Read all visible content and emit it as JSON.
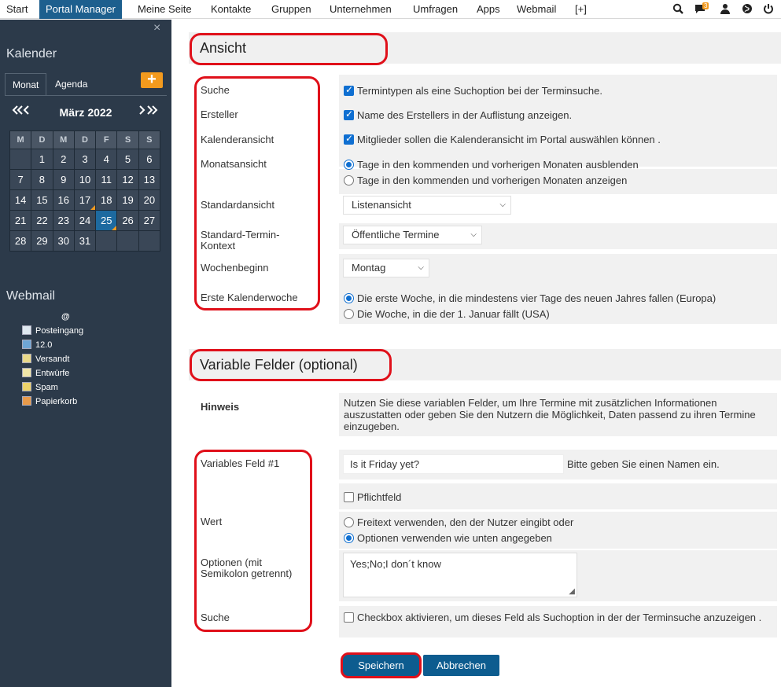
{
  "topnav": {
    "items": [
      "Start",
      "Portal Manager",
      "Meine Seite",
      "Kontakte",
      "Gruppen",
      "Unternehmen",
      "Umfragen",
      "Apps",
      "Webmail",
      "[+]"
    ],
    "notification_count": "3",
    "icons": [
      "search-zoom-icon",
      "chat-icon",
      "user-icon",
      "globe-icon",
      "power-icon"
    ]
  },
  "sidebar": {
    "close_label": "×",
    "calendar_title": "Kalender",
    "tabs": [
      "Monat",
      "Agenda"
    ],
    "add_label": "+",
    "month_label": "März 2022",
    "prev_label": "«‹",
    "next_label": "›»",
    "weekdays": [
      "M",
      "D",
      "M",
      "D",
      "F",
      "S",
      "S"
    ],
    "weeks": [
      [
        "",
        "1",
        "2",
        "3",
        "4",
        "5",
        "6"
      ],
      [
        "7",
        "8",
        "9",
        "10",
        "11",
        "12",
        "13"
      ],
      [
        "14",
        "15",
        "16",
        "17",
        "18",
        "19",
        "20"
      ],
      [
        "21",
        "22",
        "23",
        "24",
        "25",
        "26",
        "27"
      ],
      [
        "28",
        "29",
        "30",
        "31",
        "",
        "",
        ""
      ]
    ],
    "today": "25",
    "marked_days": [
      "17",
      "25"
    ],
    "webmail_title": "Webmail",
    "webmail_at": "@",
    "folders": [
      "Posteingang",
      "12.0",
      "Versandt",
      "Entwürfe",
      "Spam",
      "Papierkorb"
    ]
  },
  "ansicht": {
    "title": "Ansicht",
    "labels": {
      "suche": "Suche",
      "ersteller": "Ersteller",
      "kalenderansicht": "Kalenderansicht",
      "monatsansicht": "Monatsansicht",
      "standardansicht": "Standardansicht",
      "kontext": "Standard-Termin-Kontext",
      "wochenbeginn": "Wochenbeginn",
      "kalenderwoche": "Erste Kalenderwoche"
    },
    "cb_suche": "Termintypen als eine Suchoption bei der Terminsuche.",
    "cb_ersteller": "Name des Erstellers in der Auflistung anzeigen.",
    "cb_kalender": "Mitglieder sollen die Kalenderansicht im Portal auswählen können .",
    "monat_opt1": "Tage in den kommenden und vorherigen Monaten ausblenden",
    "monat_opt2": "Tage in den kommenden und vorherigen Monaten anzeigen",
    "standardansicht_value": "Listenansicht",
    "kontext_value": "Öffentliche Termine",
    "wochenbeginn_value": "Montag",
    "woche_opt1": "Die erste Woche, in die mindestens vier Tage des neuen Jahres fallen (Europa)",
    "woche_opt2": "Die Woche, in die der 1. Januar fällt (USA)"
  },
  "variable": {
    "title": "Variable Felder (optional)",
    "hinweis_label": "Hinweis",
    "hinweis_text": "Nutzen Sie diese variablen Felder, um Ihre Termine mit zusätzlichen Informationen auszustatten oder geben Sie den Nutzern die Möglichkeit, Daten passend zu ihren Termine einzugeben.",
    "labels": {
      "feld1": "Variables Feld #1",
      "wert": "Wert",
      "optionen": "Optionen (mit Semikolon getrennt)",
      "suche": "Suche"
    },
    "feld1_value": "Is it Friday yet?",
    "feld1_hint": "Bitte geben Sie einen Namen ein.",
    "pflichtfeld": "Pflichtfeld",
    "wert_opt1": "Freitext verwenden, den der Nutzer eingibt oder",
    "wert_opt2": "Optionen verwenden wie unten angegeben",
    "optionen_value": "Yes;No;I don´t know",
    "suche_cb": "Checkbox aktivieren, um dieses Feld als Suchoption in der der Terminsuche anzuzeigen ."
  },
  "buttons": {
    "save": "Speichern",
    "cancel": "Abbrechen"
  },
  "colors": {
    "active_nav": "#1d5f8e",
    "sidebar": "#2c3a4a",
    "accent": "#f39a1e",
    "button": "#0d5c8f",
    "highlight": "#e0101a"
  }
}
